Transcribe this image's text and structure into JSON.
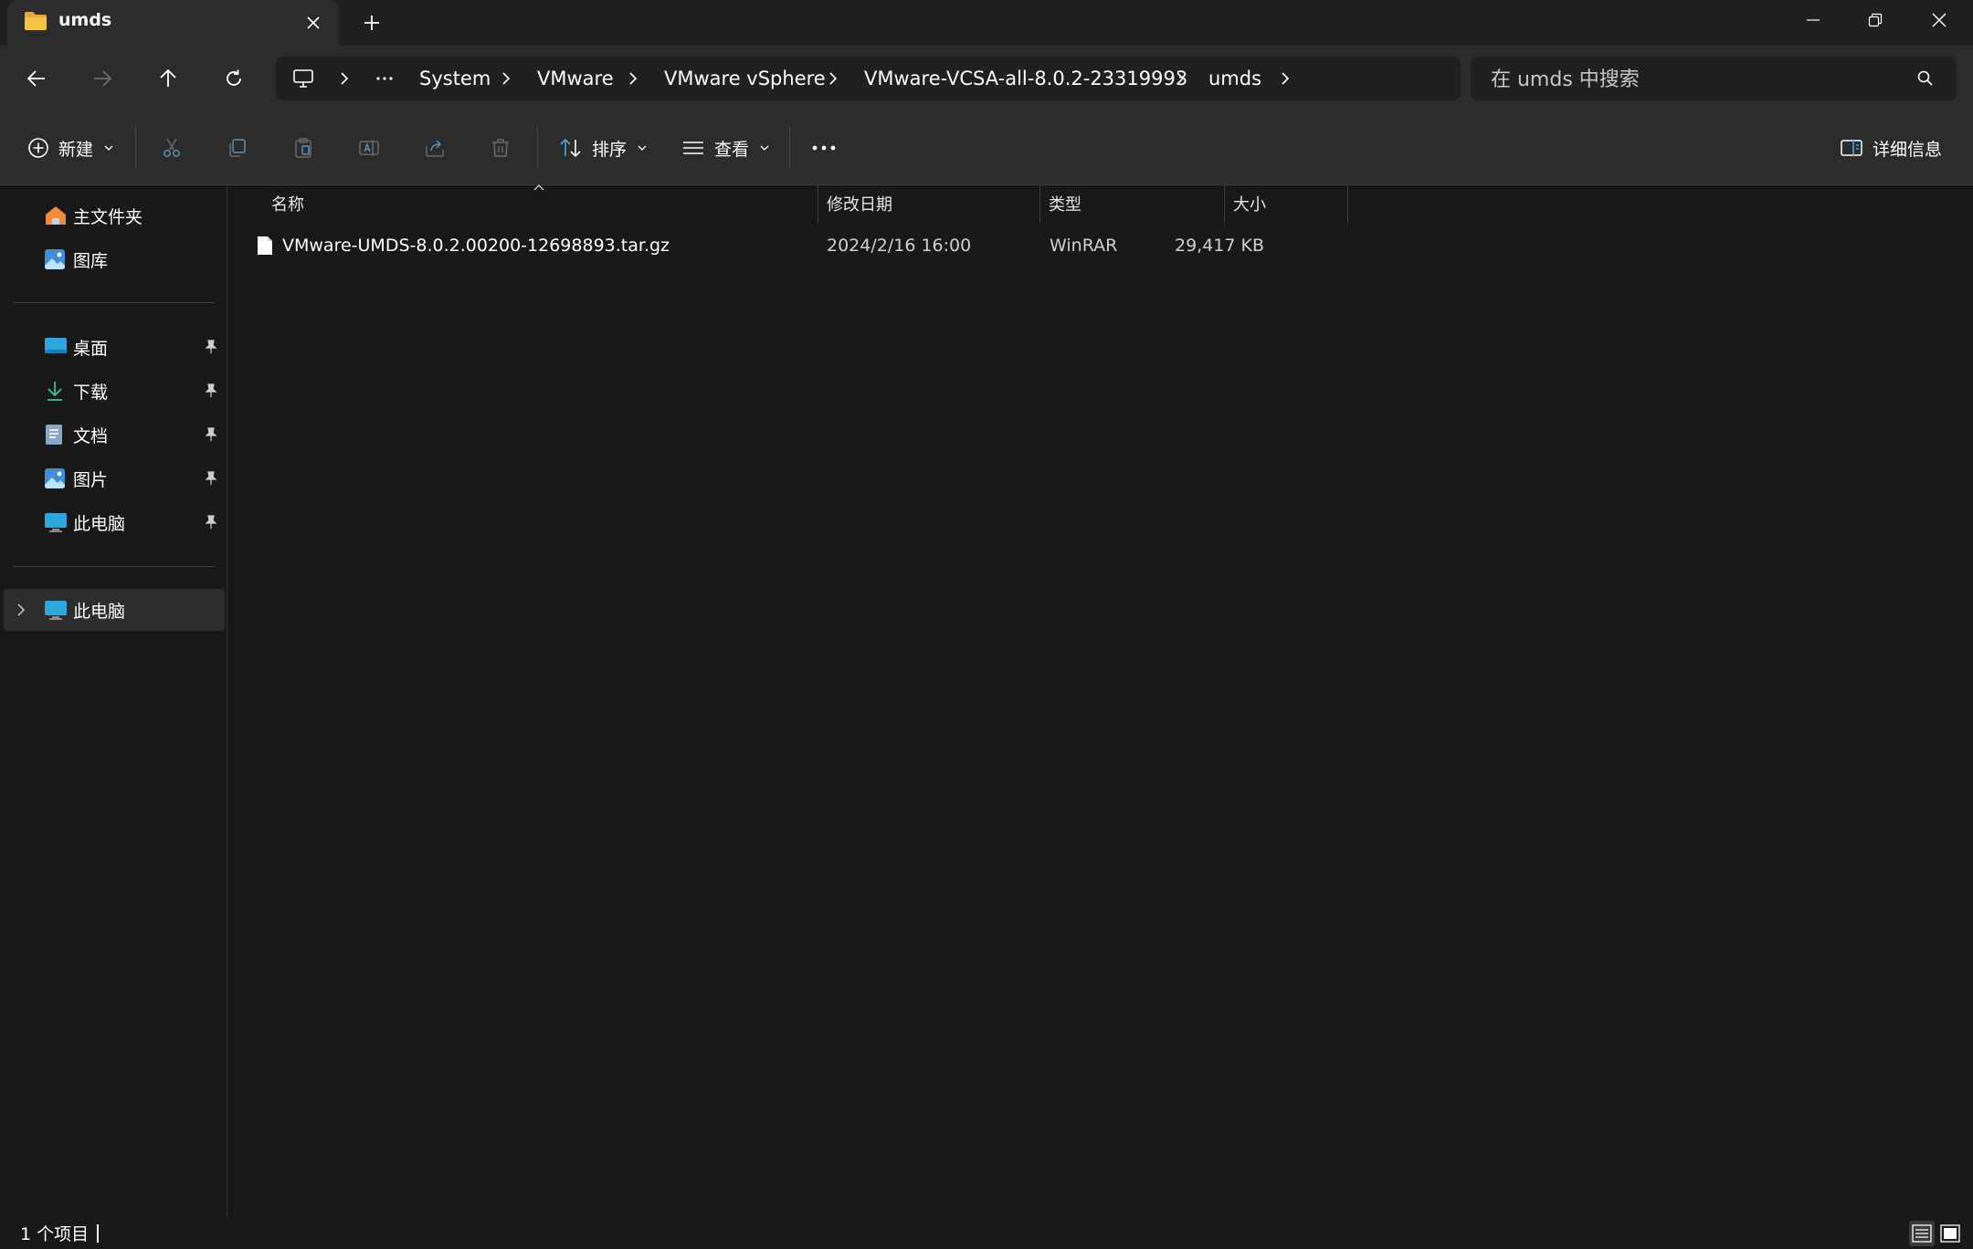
{
  "window": {
    "tab_title": "umds",
    "new_tab_label": "+",
    "controls": [
      "minimize",
      "restore",
      "close"
    ]
  },
  "nav": {
    "breadcrumb": [
      "System",
      "VMware",
      "VMware vSphere",
      "VMware-VCSA-all-8.0.2-23319993",
      "umds"
    ],
    "search_placeholder": "在 umds 中搜索"
  },
  "toolbar": {
    "new_label": "新建",
    "sort_label": "排序",
    "view_label": "查看",
    "more_label": "•••",
    "details_label": "详细信息"
  },
  "sidebar": {
    "quick": [
      {
        "label": "主文件夹",
        "icon": "home-icon"
      },
      {
        "label": "图库",
        "icon": "gallery-icon"
      }
    ],
    "pinned": [
      {
        "label": "桌面",
        "icon": "desktop-icon"
      },
      {
        "label": "下载",
        "icon": "download-icon"
      },
      {
        "label": "文档",
        "icon": "documents-icon"
      },
      {
        "label": "图片",
        "icon": "pictures-icon"
      },
      {
        "label": "此电脑",
        "icon": "this-pc-icon"
      }
    ],
    "tree": [
      {
        "label": "此电脑",
        "icon": "this-pc-icon",
        "selected": true
      }
    ]
  },
  "columns": {
    "name": "名称",
    "date": "修改日期",
    "type": "类型",
    "size": "大小"
  },
  "files": [
    {
      "name": "VMware-UMDS-8.0.2.00200-12698893.tar.gz",
      "date": "2024/2/16 16:00",
      "type": "WinRAR",
      "size": "29,417 KB"
    }
  ],
  "status": {
    "item_count": "1 个项目"
  },
  "colors": {
    "background": "#191919",
    "chrome": "#2c2c2c",
    "accent_blue": "#4aa3df",
    "folder_yellow": "#f5c342"
  }
}
